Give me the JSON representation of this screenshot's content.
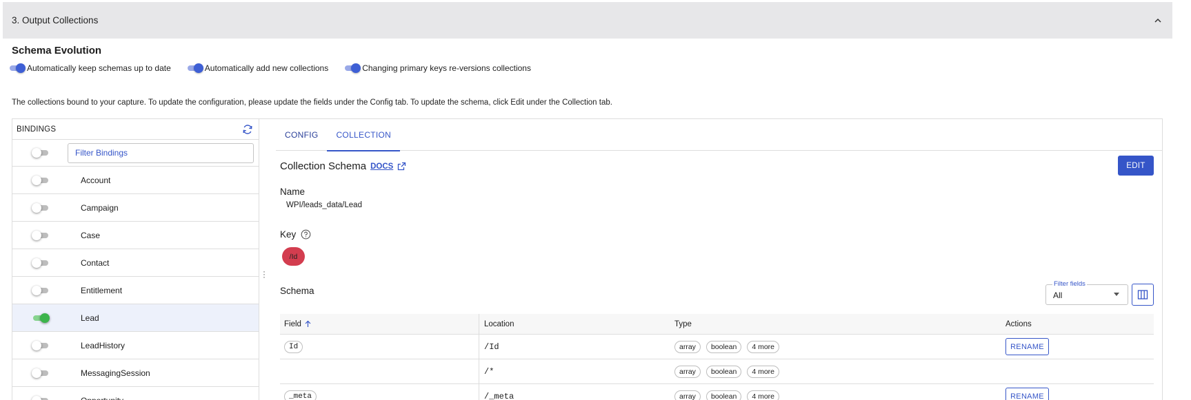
{
  "section": {
    "title": "3. Output Collections"
  },
  "schema_evolution": {
    "title": "Schema Evolution",
    "toggles": [
      {
        "label": "Automatically keep schemas up to date",
        "on": true
      },
      {
        "label": "Automatically add new collections",
        "on": true
      },
      {
        "label": "Changing primary keys re-versions collections",
        "on": true
      }
    ]
  },
  "description": "The collections bound to your capture. To update the configuration, please update the fields under the Config tab. To update the schema, click Edit under the Collection tab.",
  "bindings": {
    "header": "BINDINGS",
    "filter_placeholder": "Filter Bindings",
    "items": [
      {
        "label": "Account",
        "enabled": false
      },
      {
        "label": "Campaign",
        "enabled": false
      },
      {
        "label": "Case",
        "enabled": false
      },
      {
        "label": "Contact",
        "enabled": false
      },
      {
        "label": "Entitlement",
        "enabled": false
      },
      {
        "label": "Lead",
        "enabled": true,
        "selected": true
      },
      {
        "label": "LeadHistory",
        "enabled": false
      },
      {
        "label": "MessagingSession",
        "enabled": false
      },
      {
        "label": "Opportunity",
        "enabled": false
      }
    ]
  },
  "tabs": [
    {
      "label": "CONFIG",
      "active": false
    },
    {
      "label": "COLLECTION",
      "active": true
    }
  ],
  "collection": {
    "title": "Collection Schema",
    "docs_label": "DOCS",
    "edit_label": "EDIT",
    "name_label": "Name",
    "name_value": "WPI/leads_data/Lead",
    "key_label": "Key",
    "key_chip": "/Id",
    "schema_label": "Schema",
    "filter_fields": {
      "legend": "Filter fields",
      "value": "All"
    },
    "table": {
      "headers": {
        "field": "Field",
        "location": "Location",
        "type": "Type",
        "actions": "Actions"
      },
      "rows": [
        {
          "field": "Id",
          "location": "/Id",
          "types": [
            "array",
            "boolean",
            "4 more"
          ],
          "action": "RENAME"
        },
        {
          "field": "",
          "location": "/*",
          "types": [
            "array",
            "boolean",
            "4 more"
          ],
          "action": ""
        },
        {
          "field": "_meta",
          "location": "/_meta",
          "types": [
            "array",
            "boolean",
            "4 more"
          ],
          "action": "RENAME"
        }
      ]
    }
  },
  "colors": {
    "accent": "#3555c8",
    "key_chip": "#d33d4f",
    "enabled_toggle": "#3cb44b"
  }
}
